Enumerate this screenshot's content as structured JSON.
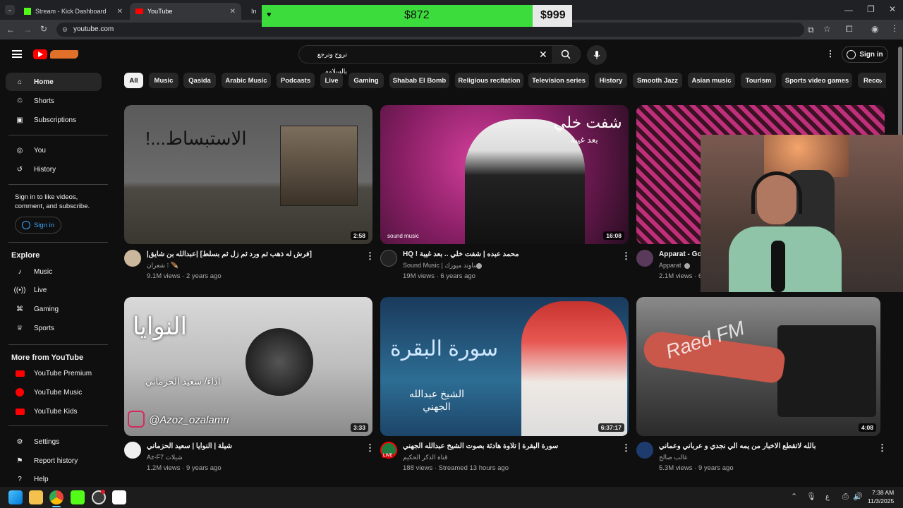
{
  "browser": {
    "tabs": [
      {
        "label": "Stream - Kick Dashboard"
      },
      {
        "label": "YouTube"
      },
      {
        "label": "In"
      }
    ],
    "url": "youtube.com"
  },
  "overlay": {
    "amount": "$872",
    "goal": "$999"
  },
  "search": {
    "query": "تروح وترجع بالسلامه"
  },
  "header": {
    "sign_in": "Sign in"
  },
  "sidebar": {
    "main": [
      "Home",
      "Shorts",
      "Subscriptions"
    ],
    "you": [
      "You",
      "History"
    ],
    "signin_prompt": "Sign in to like videos, comment, and subscribe.",
    "signin_button": "Sign in",
    "explore_title": "Explore",
    "explore": [
      "Music",
      "Live",
      "Gaming",
      "Sports"
    ],
    "more_title": "More from YouTube",
    "more": [
      "YouTube Premium",
      "YouTube Music",
      "YouTube Kids"
    ],
    "bottom": [
      "Settings",
      "Report history",
      "Help"
    ]
  },
  "chips": [
    "All",
    "Music",
    "Qasida",
    "Arabic Music",
    "Podcasts",
    "Live",
    "Gaming",
    "Shabab El Bomb",
    "Religious recitation",
    "Television series",
    "History",
    "Smooth Jazz",
    "Asian music",
    "Tourism",
    "Sports video games",
    "Reco"
  ],
  "videos": [
    {
      "title": "[فرش له ذهب ثم ورد ثم زل ثم بسلط] |عبدالله بن شايق|",
      "channel": "شعران ⁝ 🪶",
      "meta": "9.1M views · 2 years ago",
      "duration": "2:58",
      "thumb_text": "الاستبساط...!"
    },
    {
      "title": "محمد عبده | شفت خلي .. بعد غيبة ! HQ",
      "channel": "Sound Music | ساوند ميوزك",
      "meta": "19M views · 6 years ago",
      "duration": "16:08",
      "thumb_text": "شفت خلي",
      "thumb_sub": "بعد غيبة",
      "brand": "sound music"
    },
    {
      "title": "Apparat - Go",
      "channel": "Apparat",
      "meta": "2.1M views · 6",
      "duration": ""
    },
    {
      "title": "شيلة | النوايا | سعيد الحزماني",
      "channel": "Az-F7 شيلات",
      "meta": "1.2M views · 9 years ago",
      "duration": "3:33",
      "thumb_text": "النوايا",
      "thumb_sub": "اداء/ سعيد الحزماني",
      "handle": "@Azoz_ozalamri"
    },
    {
      "title": "سورة البقرة | تلاوة هادئة بصوت الشيخ عبدالله الجهني",
      "channel": "قناة الذكر الحكيم",
      "meta": "188 views · Streamed 13 hours ago",
      "duration": "6:37:17",
      "thumb_text": "سورة البقرة",
      "thumb_sub": "الشيخ عبدالله الجهني",
      "live": "LIVE"
    },
    {
      "title": "بالله لاتقطع الاخبار من يمه الي نجدي و عرباني وعماني",
      "channel": "غالب صالح",
      "meta": "5.3M views · 9 years ago",
      "duration": "4:08",
      "thumb_text": "Raed FM"
    }
  ],
  "taskbar": {
    "time": "7:38 AM",
    "date": "11/3/2025",
    "lang": "ع"
  },
  "colors": {
    "yt_red": "#ff0000",
    "overlay_green": "#3ddc3d"
  }
}
